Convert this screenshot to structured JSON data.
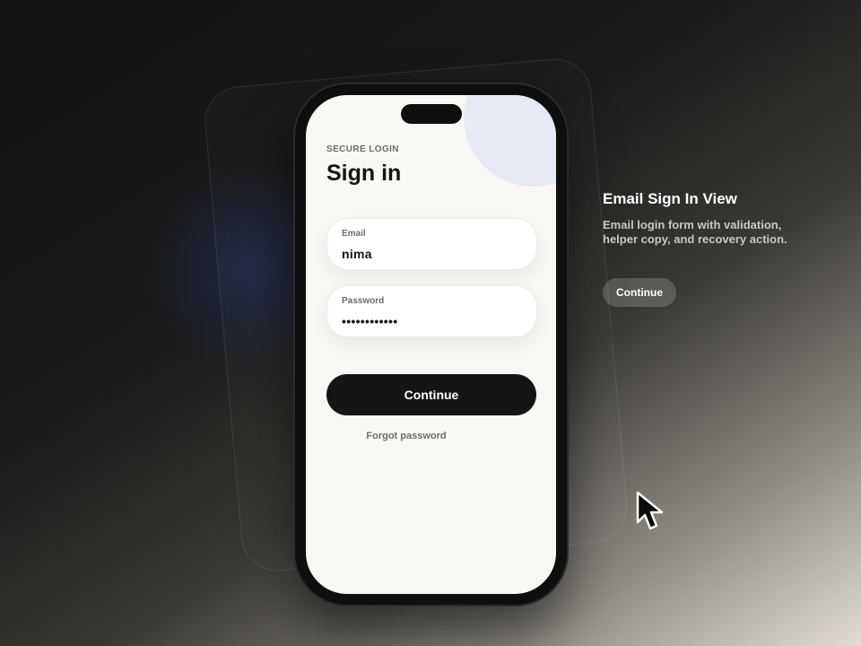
{
  "login": {
    "eyebrow": "SECURE LOGIN",
    "title": "Sign in",
    "email_label": "Email",
    "email_value": "nima",
    "password_label": "Password",
    "password_value": "••••••••••••",
    "continue_label": "Continue",
    "forgot_label": "Forgot password"
  },
  "side": {
    "title": "Email Sign In View",
    "description": "Email login form with validation, helper copy, and recovery action.",
    "button_label": "Continue"
  },
  "icons": {
    "cursor": "mouse-pointer-icon"
  },
  "colors": {
    "primary_button": "#151515",
    "screen_background": "#f8f7f3",
    "accent_circle": "#e7eaf5"
  }
}
